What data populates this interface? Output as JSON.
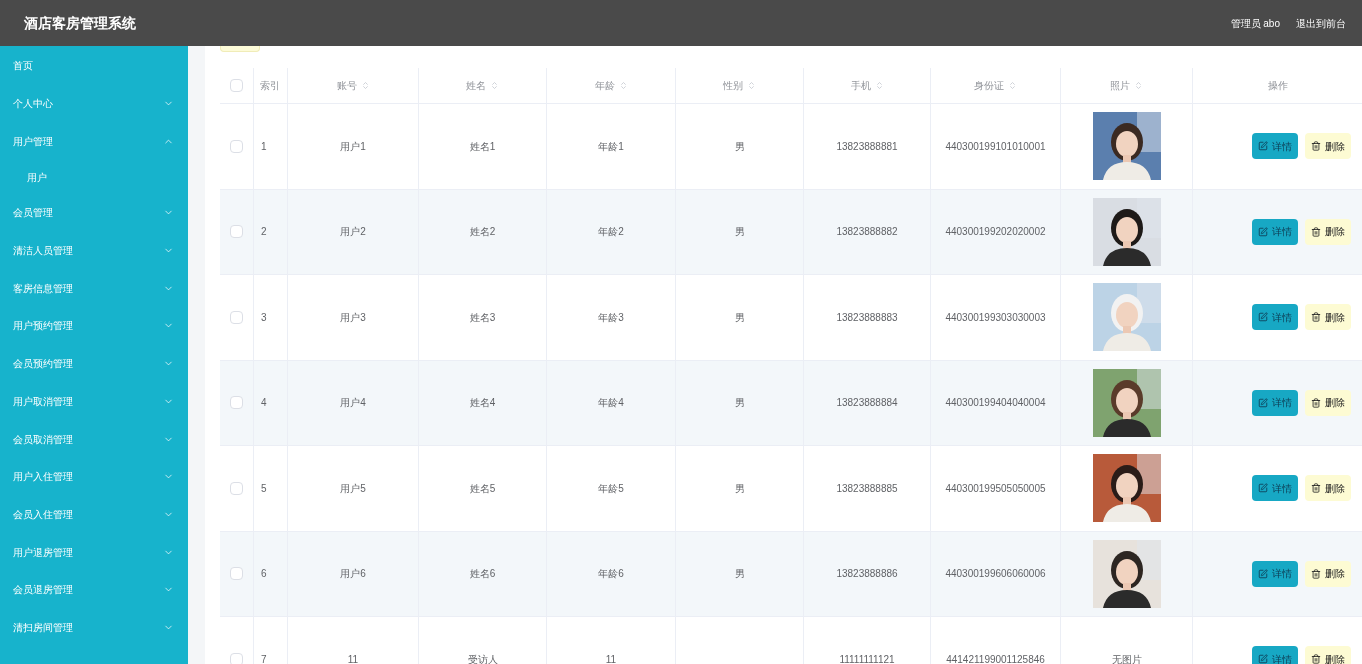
{
  "header": {
    "title": "酒店客房管理系统",
    "user": "管理员 abo",
    "exit_link": "退出到前台"
  },
  "sidebar": {
    "items": [
      {
        "label": "首页",
        "kind": "link"
      },
      {
        "label": "个人中心",
        "kind": "menu",
        "expanded": false
      },
      {
        "label": "用户管理",
        "kind": "menu",
        "expanded": true,
        "children": [
          {
            "label": "用户"
          }
        ]
      },
      {
        "label": "会员管理",
        "kind": "menu",
        "expanded": false
      },
      {
        "label": "清洁人员管理",
        "kind": "menu",
        "expanded": false
      },
      {
        "label": "客房信息管理",
        "kind": "menu",
        "expanded": false
      },
      {
        "label": "用户预约管理",
        "kind": "menu",
        "expanded": false
      },
      {
        "label": "会员预约管理",
        "kind": "menu",
        "expanded": false
      },
      {
        "label": "用户取消管理",
        "kind": "menu",
        "expanded": false
      },
      {
        "label": "会员取消管理",
        "kind": "menu",
        "expanded": false
      },
      {
        "label": "用户入住管理",
        "kind": "menu",
        "expanded": false
      },
      {
        "label": "会员入住管理",
        "kind": "menu",
        "expanded": false
      },
      {
        "label": "用户退房管理",
        "kind": "menu",
        "expanded": false
      },
      {
        "label": "会员退房管理",
        "kind": "menu",
        "expanded": false
      },
      {
        "label": "清扫房间管理",
        "kind": "menu",
        "expanded": false
      }
    ]
  },
  "table": {
    "columns": [
      {
        "label": "索引",
        "sortable": false
      },
      {
        "label": "账号",
        "sortable": true
      },
      {
        "label": "姓名",
        "sortable": true
      },
      {
        "label": "年龄",
        "sortable": true
      },
      {
        "label": "性别",
        "sortable": true
      },
      {
        "label": "手机",
        "sortable": true
      },
      {
        "label": "身份证",
        "sortable": true
      },
      {
        "label": "照片",
        "sortable": true
      },
      {
        "label": "操作",
        "sortable": false
      }
    ],
    "all_checked": false,
    "rows": [
      {
        "index": "1",
        "account": "用户1",
        "name": "姓名1",
        "age": "年龄1",
        "sex": "男",
        "phone": "13823888881",
        "id_card": "440300199101010001",
        "checked": false,
        "actions": [
          "详情",
          "删除"
        ]
      },
      {
        "index": "2",
        "account": "用户2",
        "name": "姓名2",
        "age": "年龄2",
        "sex": "男",
        "phone": "13823888882",
        "id_card": "440300199202020002",
        "checked": false,
        "actions": [
          "详情",
          "删除"
        ]
      },
      {
        "index": "3",
        "account": "用户3",
        "name": "姓名3",
        "age": "年龄3",
        "sex": "男",
        "phone": "13823888883",
        "id_card": "440300199303030003",
        "checked": false,
        "actions": [
          "详情",
          "删除"
        ]
      },
      {
        "index": "4",
        "account": "用户4",
        "name": "姓名4",
        "age": "年龄4",
        "sex": "男",
        "phone": "13823888884",
        "id_card": "440300199404040004",
        "checked": false,
        "actions": [
          "详情",
          "删除"
        ]
      },
      {
        "index": "5",
        "account": "用户5",
        "name": "姓名5",
        "age": "年龄5",
        "sex": "男",
        "phone": "13823888885",
        "id_card": "440300199505050005",
        "checked": false,
        "actions": [
          "详情",
          "删除"
        ]
      },
      {
        "index": "6",
        "account": "用户6",
        "name": "姓名6",
        "age": "年龄6",
        "sex": "男",
        "phone": "13823888886",
        "id_card": "440300199606060006",
        "checked": false,
        "actions": [
          "详情",
          "删除"
        ]
      },
      {
        "index": "7",
        "account": "11",
        "name": "受访人",
        "age": "11",
        "phone": "11111111121",
        "id_card": "441421199001125846",
        "photo": {
          "kind": "none",
          "text": "无图片"
        },
        "checked": false,
        "actions": [
          "详情",
          "删除"
        ]
      }
    ]
  }
}
